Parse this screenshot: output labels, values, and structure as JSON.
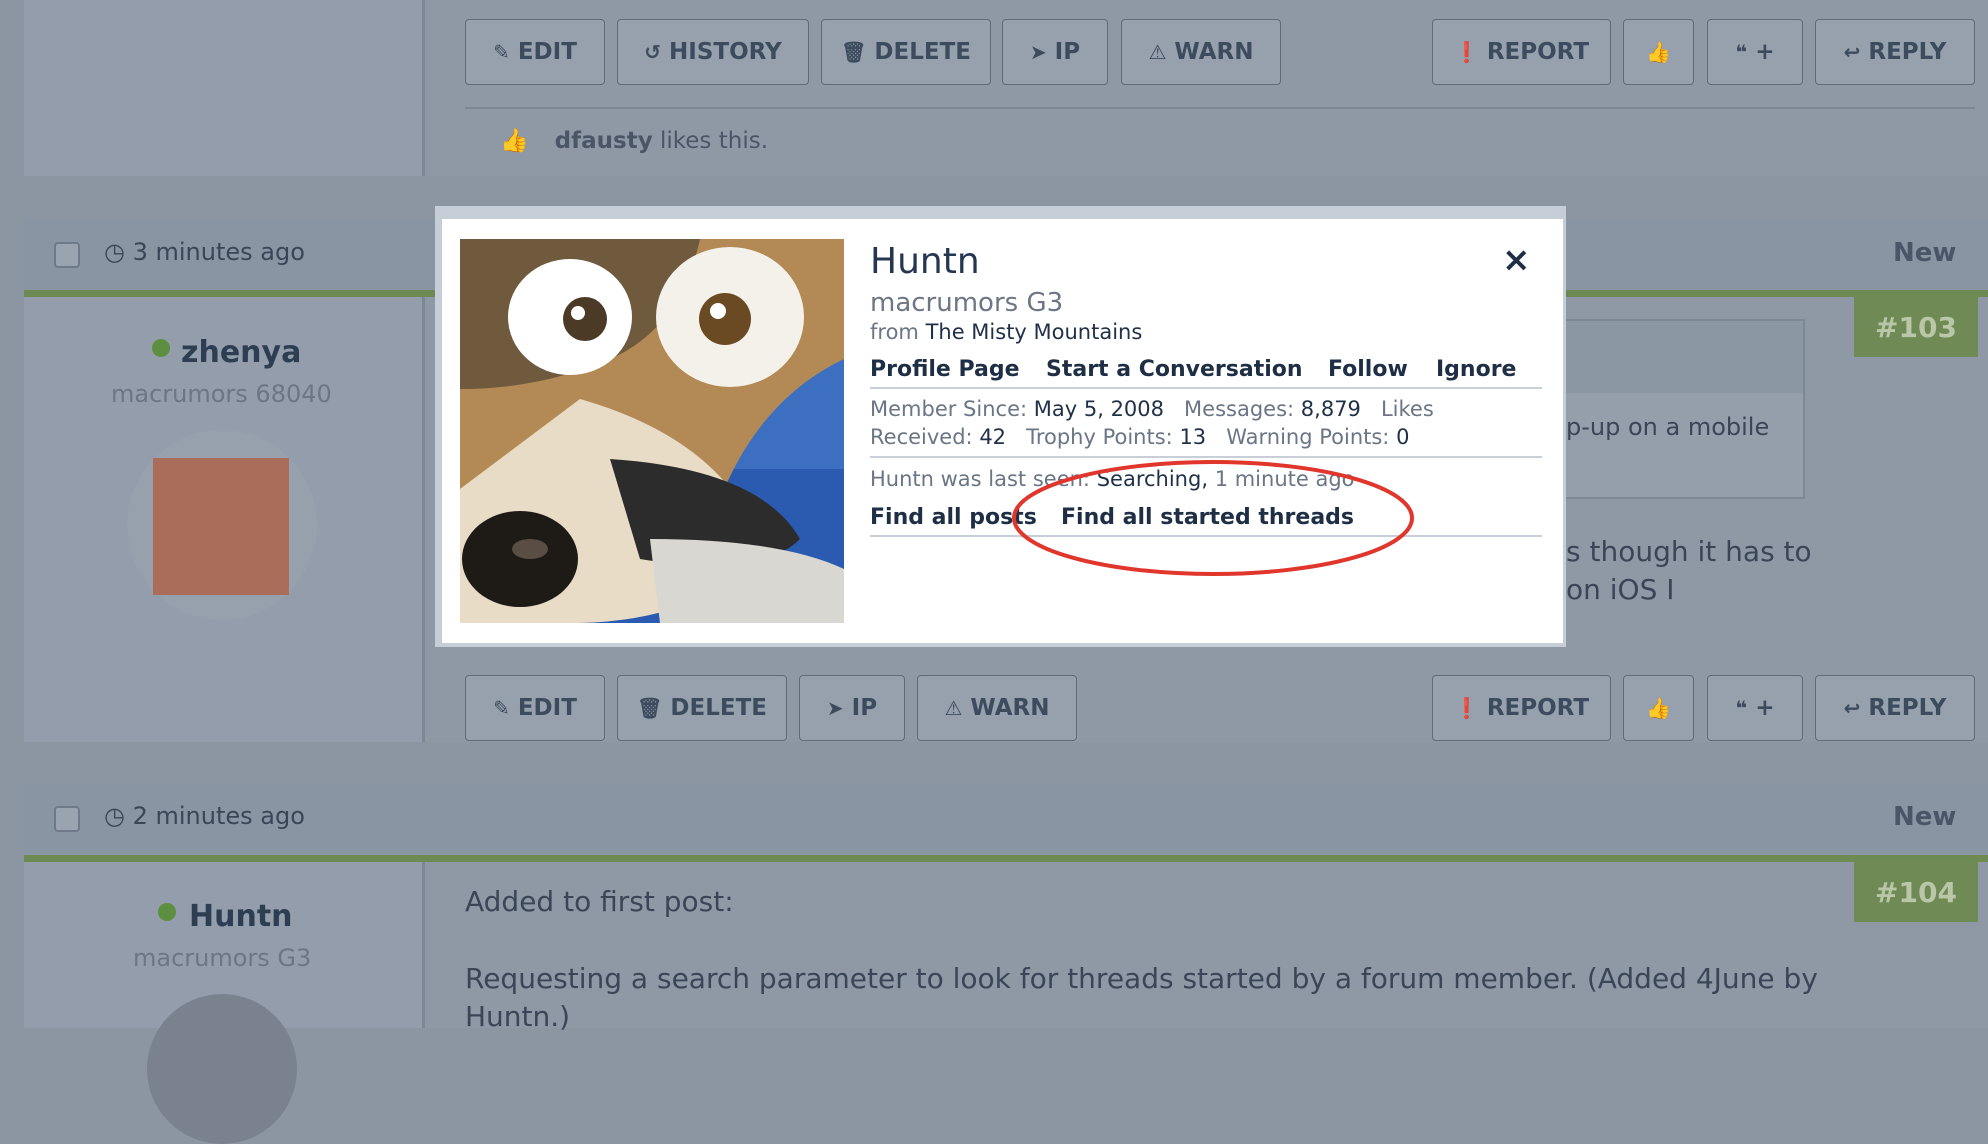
{
  "top_post": {
    "buttons_left": [
      {
        "label": "EDIT",
        "icon": "✎",
        "name": "edit"
      },
      {
        "label": "HISTORY",
        "icon": "↺",
        "name": "history"
      },
      {
        "label": "DELETE",
        "icon": "🗑",
        "name": "delete"
      },
      {
        "label": "IP",
        "icon": "➤",
        "name": "ip"
      },
      {
        "label": "WARN",
        "icon": "⚠",
        "name": "warn"
      }
    ],
    "buttons_right": [
      {
        "label": "REPORT",
        "icon": "❗",
        "name": "report"
      },
      {
        "label": "",
        "icon": "👍",
        "name": "like"
      },
      {
        "label": "+",
        "icon": "❝",
        "name": "multiquote"
      },
      {
        "label": "REPLY",
        "icon": "↩",
        "name": "reply"
      }
    ],
    "likes_user": "dfausty",
    "likes_suffix": " likes this."
  },
  "post_103": {
    "time": "3 minutes ago",
    "new_label": "New",
    "number": "#103",
    "username": "zhenya",
    "user_title": "macrumors 68040",
    "content_fragment_1": "p-up on a mobile",
    "content_fragment_2": "s though it has to",
    "content_fragment_3": "on iOS I",
    "buttons_left": [
      {
        "label": "EDIT",
        "icon": "✎",
        "name": "edit"
      },
      {
        "label": "DELETE",
        "icon": "🗑",
        "name": "delete"
      },
      {
        "label": "IP",
        "icon": "➤",
        "name": "ip"
      },
      {
        "label": "WARN",
        "icon": "⚠",
        "name": "warn"
      }
    ],
    "buttons_right": [
      {
        "label": "REPORT",
        "icon": "❗",
        "name": "report"
      },
      {
        "label": "",
        "icon": "👍",
        "name": "like"
      },
      {
        "label": "+",
        "icon": "❝",
        "name": "multiquote"
      },
      {
        "label": "REPLY",
        "icon": "↩",
        "name": "reply"
      }
    ]
  },
  "post_104": {
    "time": "2 minutes ago",
    "new_label": "New",
    "number": "#104",
    "username": "Huntn",
    "user_title": "macrumors G3",
    "line1": "Added to first post:",
    "line2": "Requesting a search parameter to look for threads started by a forum member. (Added 4June by",
    "line3": "Huntn.)"
  },
  "popup": {
    "name": "Huntn",
    "title": "macrumors G3",
    "from_label": "from",
    "location": "The Misty Mountains",
    "actions": [
      "Profile Page",
      "Start a Conversation",
      "Follow",
      "Ignore"
    ],
    "member_since_label": "Member Since:",
    "member_since": "May 5, 2008",
    "messages_label": "Messages:",
    "messages": "8,879",
    "likes_label_1": "Likes",
    "likes_label_2": "Received:",
    "likes": "42",
    "trophy_label": "Trophy Points:",
    "trophy": "13",
    "warning_label": "Warning Points:",
    "warning": "0",
    "last_seen_prefix": "Huntn was last seen:",
    "last_seen_activity": "Searching,",
    "last_seen_time": "1 minute ago",
    "find_posts": "Find all posts",
    "find_threads": "Find all started threads",
    "close_icon": "×"
  }
}
